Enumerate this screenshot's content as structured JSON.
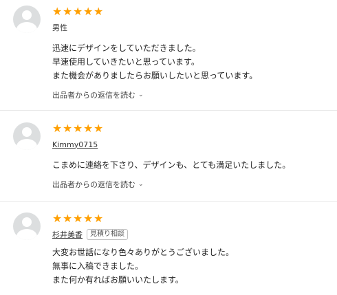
{
  "reviews": [
    {
      "stars": [
        "★",
        "★",
        "★",
        "★",
        "★"
      ],
      "name": "男性",
      "name_linked": false,
      "badge": "",
      "lines": [
        "迅速にデザインをしていただきました。",
        "早速使用していきたいと思っています。",
        "また機会がありましたらお願いしたいと思っています。"
      ],
      "reply_label": "出品者からの返信を読む",
      "chevron": "⌄"
    },
    {
      "stars": [
        "★",
        "★",
        "★",
        "★",
        "★"
      ],
      "name": "Kimmy0715",
      "name_linked": true,
      "badge": "",
      "lines": [
        "こまめに連絡を下さり、デザインも、とても満足いたしました。"
      ],
      "reply_label": "出品者からの返信を読む",
      "chevron": "⌄"
    },
    {
      "stars": [
        "★",
        "★",
        "★",
        "★",
        "★"
      ],
      "name": "杉井美香",
      "name_linked": true,
      "badge": "見積り相談",
      "lines": [
        "大変お世話になり色々ありがとうございました。",
        "無事に入稿できました。",
        "また何か有ればお願いいたします。"
      ],
      "reply_label": "",
      "chevron": ""
    }
  ],
  "colors": {
    "star": "#ff9f00",
    "avatar": "#dcdedf",
    "divider": "#e8e8e8"
  }
}
